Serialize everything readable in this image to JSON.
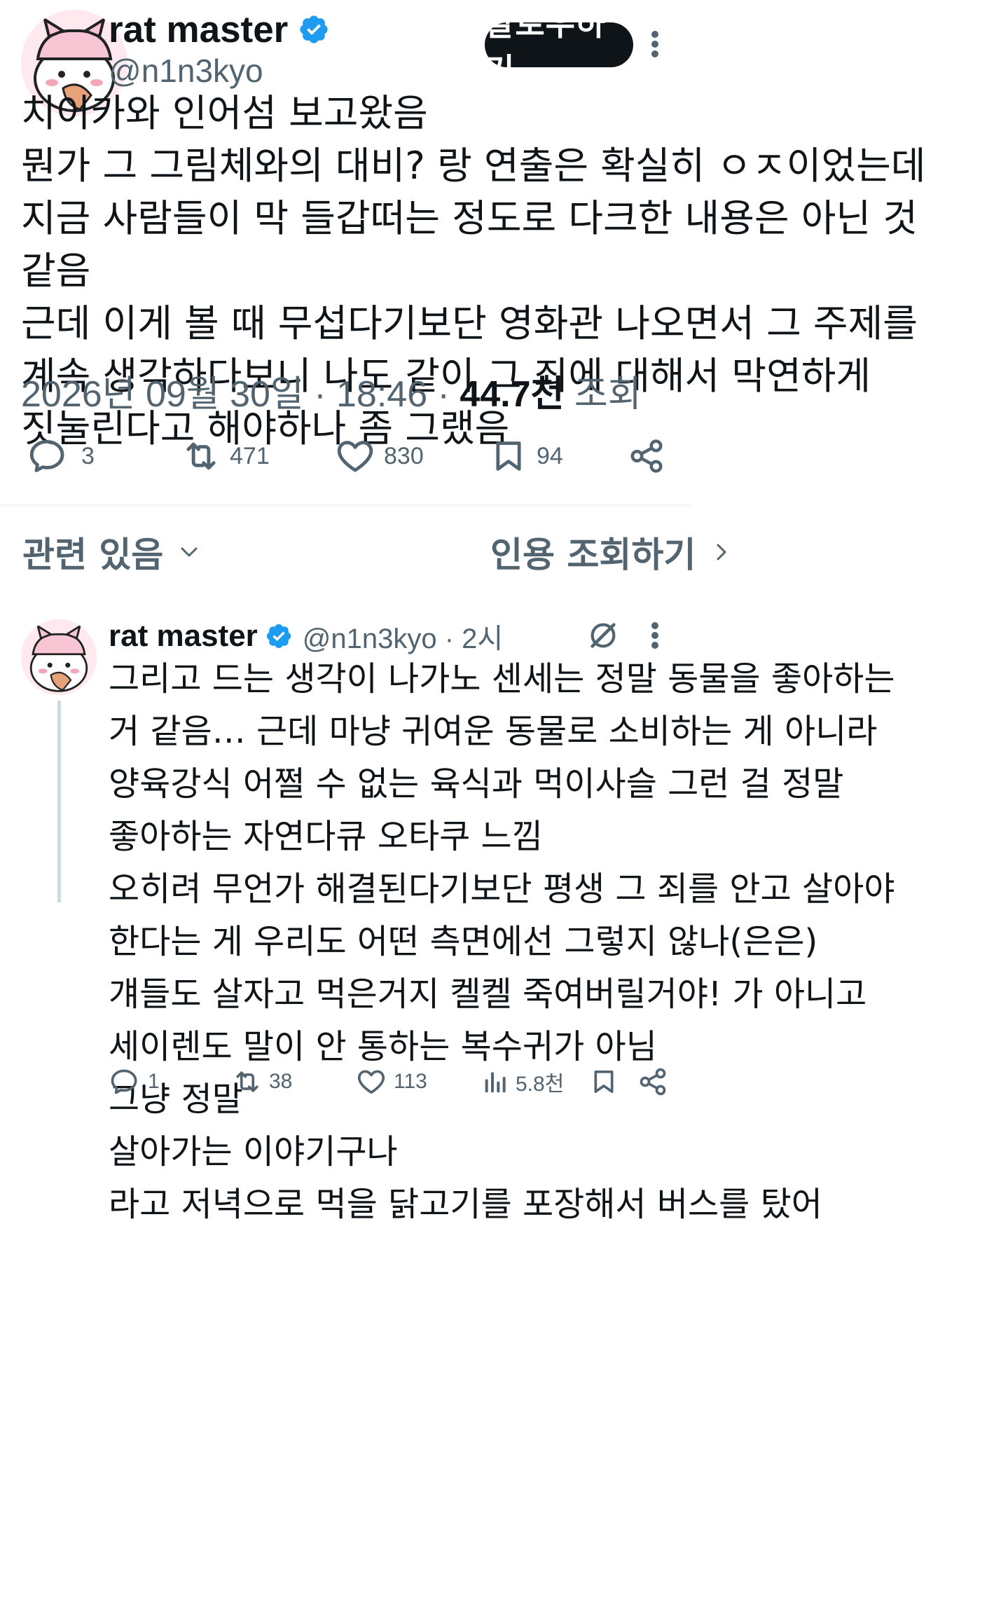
{
  "main_tweet": {
    "author_name": "rat master",
    "handle": "@n1n3kyo",
    "follow_label": "팔로우하기",
    "text_lines": [
      "치이카와 인어섬 보고왔음",
      "뭔가 그 그림체와의 대비? 랑 연출은 확실히 ㅇㅈ이었는데",
      "지금 사람들이 막 들갑떠는 정도로 다크한 내용은 아닌 것",
      "같음",
      "근데 이게 볼 때 무섭다기보단 영화관 나오면서 그 주제를",
      "계속 생각하다보니 나도 같이 그 죄에 대해서 막연하게",
      "짓눌린다고 해야하나 좀 그랬음"
    ],
    "timestamp": "2026년 09월 30일 · 18:46 ·",
    "views_count": "44.7천",
    "views_label": "조회",
    "replies": "3",
    "reposts": "471",
    "likes": "830",
    "bookmarks": "94"
  },
  "related": {
    "label": "관련 있음",
    "quote_label": "인용 조회하기"
  },
  "reply_tweet": {
    "author_name": "rat master",
    "handle_time": "@n1n3kyo · 2시",
    "text_lines": [
      "그리고 드는 생각이 나가노 센세는 정말 동물을 좋아하는",
      "거 같음… 근데 마냥 귀여운 동물로 소비하는 게 아니라",
      "양육강식 어쩔 수 없는 육식과 먹이사슬 그런 걸 정말",
      "좋아하는 자연다큐 오타쿠 느낌",
      "오히려 무언가 해결된다기보단 평생 그 죄를 안고 살아야",
      "한다는 게 우리도 어떤 측면에선 그렇지 않나(은은)",
      "걔들도 살자고 먹은거지 켈켈 죽여버릴거야! 가 아니고",
      "세이렌도 말이 안 통하는 복수귀가 아님",
      "그냥 정말",
      "살아가는 이야기구나",
      "라고 저녁으로 먹을 닭고기를 포장해서 버스를 탔어"
    ],
    "replies": "1",
    "reposts": "38",
    "likes": "113",
    "views": "5.8천"
  },
  "colors": {
    "text": "#0f1419",
    "secondary": "#536471",
    "verified": "#1d9bf0",
    "divider": "#eff3f4",
    "follow_bg": "#0f1419"
  },
  "icons": [
    "verified-badge-icon",
    "more-icon",
    "reply-icon",
    "repost-icon",
    "like-icon",
    "bookmark-icon",
    "share-icon",
    "chevron-down-icon",
    "chevron-right-icon",
    "grok-icon",
    "views-icon"
  ]
}
